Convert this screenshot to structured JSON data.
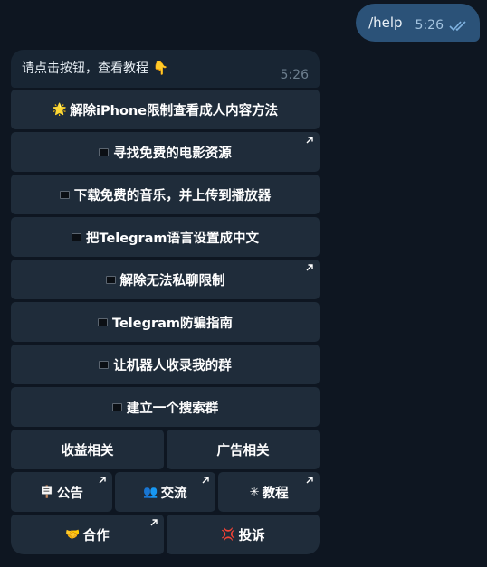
{
  "outgoing": {
    "text": "/help",
    "time": "5:26"
  },
  "incoming": {
    "text": "请点击按钮，查看教程",
    "emoji": "👇",
    "time": "5:26"
  },
  "keyboard": {
    "rows": [
      [
        {
          "icon": "🌟",
          "label": "解除iPhone限制查看成人内容方法",
          "link": false
        }
      ],
      [
        {
          "icon": "square",
          "label": "寻找免费的电影资源",
          "link": true
        }
      ],
      [
        {
          "icon": "square",
          "label": "下载免费的音乐，并上传到播放器",
          "link": false
        }
      ],
      [
        {
          "icon": "square",
          "label": "把Telegram语言设置成中文",
          "link": false
        }
      ],
      [
        {
          "icon": "square",
          "label": "解除无法私聊限制",
          "link": true
        }
      ],
      [
        {
          "icon": "square",
          "label": "Telegram防骗指南",
          "link": false
        }
      ],
      [
        {
          "icon": "square",
          "label": "让机器人收录我的群",
          "link": false
        }
      ],
      [
        {
          "icon": "square",
          "label": "建立一个搜索群",
          "link": false
        }
      ],
      [
        {
          "icon": "",
          "label": "收益相关",
          "link": false
        },
        {
          "icon": "",
          "label": "广告相关",
          "link": false
        }
      ],
      [
        {
          "icon": "🪧",
          "label": "公告",
          "link": true
        },
        {
          "icon": "👥",
          "label": "交流",
          "link": true
        },
        {
          "icon": "✳",
          "label": "教程",
          "link": true
        }
      ],
      [
        {
          "icon": "🤝",
          "label": "合作",
          "link": true
        },
        {
          "icon": "💢",
          "label": "投诉",
          "link": false
        }
      ]
    ]
  }
}
